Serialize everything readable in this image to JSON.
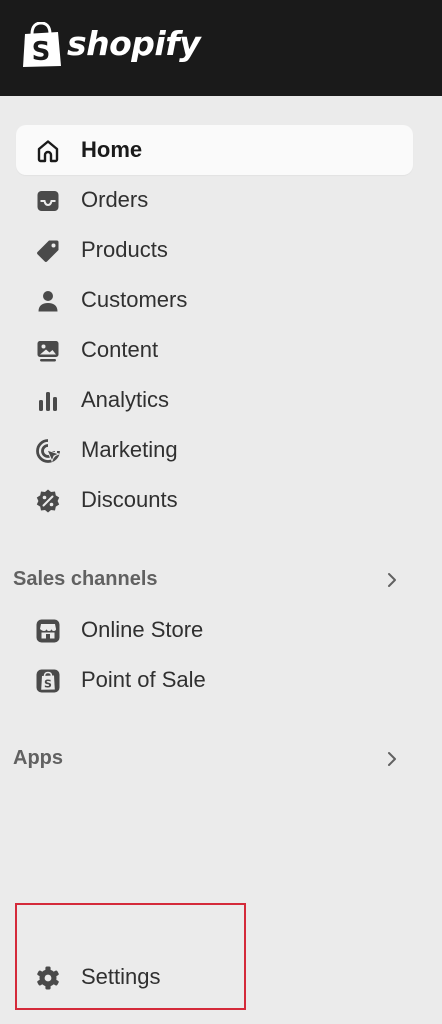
{
  "brand": {
    "logo_text": "shopify",
    "logo_letter": "S"
  },
  "nav": {
    "items": [
      {
        "label": "Home",
        "icon": "home-icon",
        "active": true
      },
      {
        "label": "Orders",
        "icon": "inbox-icon"
      },
      {
        "label": "Products",
        "icon": "tag-icon"
      },
      {
        "label": "Customers",
        "icon": "person-icon"
      },
      {
        "label": "Content",
        "icon": "image-icon"
      },
      {
        "label": "Analytics",
        "icon": "bar-chart-icon"
      },
      {
        "label": "Marketing",
        "icon": "target-icon"
      },
      {
        "label": "Discounts",
        "icon": "discount-icon"
      }
    ]
  },
  "sales_channels": {
    "label": "Sales channels",
    "items": [
      {
        "label": "Online Store",
        "icon": "storefront-icon"
      },
      {
        "label": "Point of Sale",
        "icon": "pos-icon"
      }
    ]
  },
  "apps": {
    "label": "Apps"
  },
  "settings": {
    "label": "Settings",
    "icon": "gear-icon"
  },
  "colors": {
    "topbar": "#1a1a1a",
    "sidebar_bg": "#ebebeb",
    "active_bg": "#fafafa",
    "text": "#303030",
    "section_text": "#616161",
    "highlight": "#d42a3a"
  }
}
